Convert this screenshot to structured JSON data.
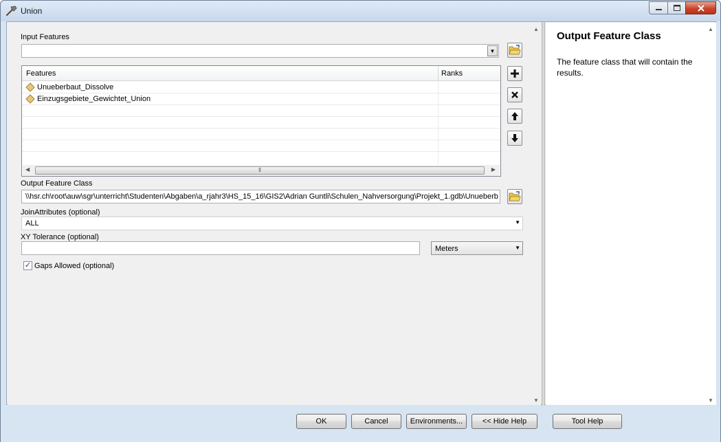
{
  "window": {
    "title": "Union"
  },
  "input_features": {
    "label": "Input Features",
    "value": ""
  },
  "features_table": {
    "headers": [
      "Features",
      "Ranks"
    ],
    "rows": [
      {
        "feature": "Unueberbaut_Dissolve",
        "rank": ""
      },
      {
        "feature": "Einzugsgebiete_Gewichtet_Union",
        "rank": ""
      }
    ]
  },
  "output_feature_class": {
    "label": "Output Feature Class",
    "value": "\\\\hsr.ch\\root\\auw\\sgr\\unterricht\\Studenten\\Abgaben\\a_rjahr3\\HS_15_16\\GIS2\\Adrian Guntli\\Schulen_Nahversorgung\\Projekt_1.gdb\\Unueberb"
  },
  "join_attributes": {
    "label": "JoinAttributes (optional)",
    "value": "ALL"
  },
  "xy_tolerance": {
    "label": "XY Tolerance (optional)",
    "value": "",
    "unit": "Meters"
  },
  "gaps_allowed": {
    "label": "Gaps Allowed (optional)",
    "checked": true,
    "check_glyph": "✓"
  },
  "help": {
    "title": "Output Feature Class",
    "text": "The feature class that will contain the results."
  },
  "buttons": {
    "ok": "OK",
    "cancel": "Cancel",
    "environments": "Environments...",
    "hide_help": "<< Hide Help",
    "tool_help": "Tool Help"
  },
  "colors": {
    "window_frame": "#d7e4f2",
    "feature_icon": "#e8c878",
    "close_button": "#c9462b"
  }
}
